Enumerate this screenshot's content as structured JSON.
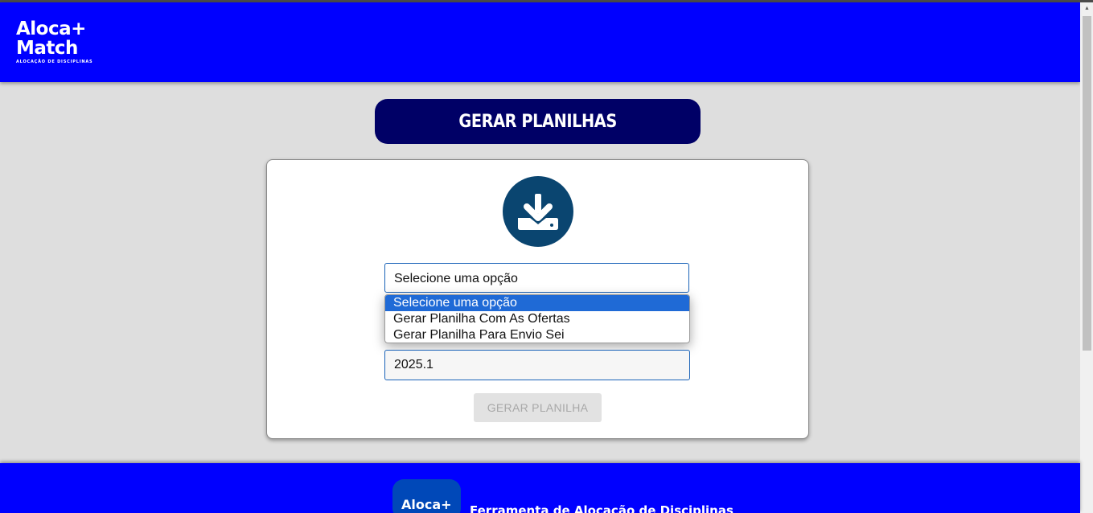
{
  "brand": {
    "logo_line1": "Aloca+",
    "logo_line2": "Match",
    "logo_tagline": "ALOCAÇÃO DE DISCIPLINAS"
  },
  "page": {
    "title": "GERAR PLANILHAS"
  },
  "form": {
    "select_value": "Selecione uma opção",
    "options": [
      "Selecione uma opção",
      "Gerar Planilha Com As Ofertas",
      "Gerar Planilha Para Envio Sei"
    ],
    "period_value": "2025.1",
    "submit_label": "GERAR PLANILHA"
  },
  "footer": {
    "logo_text": "Aloca+",
    "caption": "Ferramenta de Alocação de Disciplinas"
  },
  "icons": {
    "main": "download-icon"
  },
  "colors": {
    "header": "#0000ff",
    "title_banner": "#000066",
    "icon_circle": "#0a4570",
    "selected_option": "#1f6ad6"
  }
}
